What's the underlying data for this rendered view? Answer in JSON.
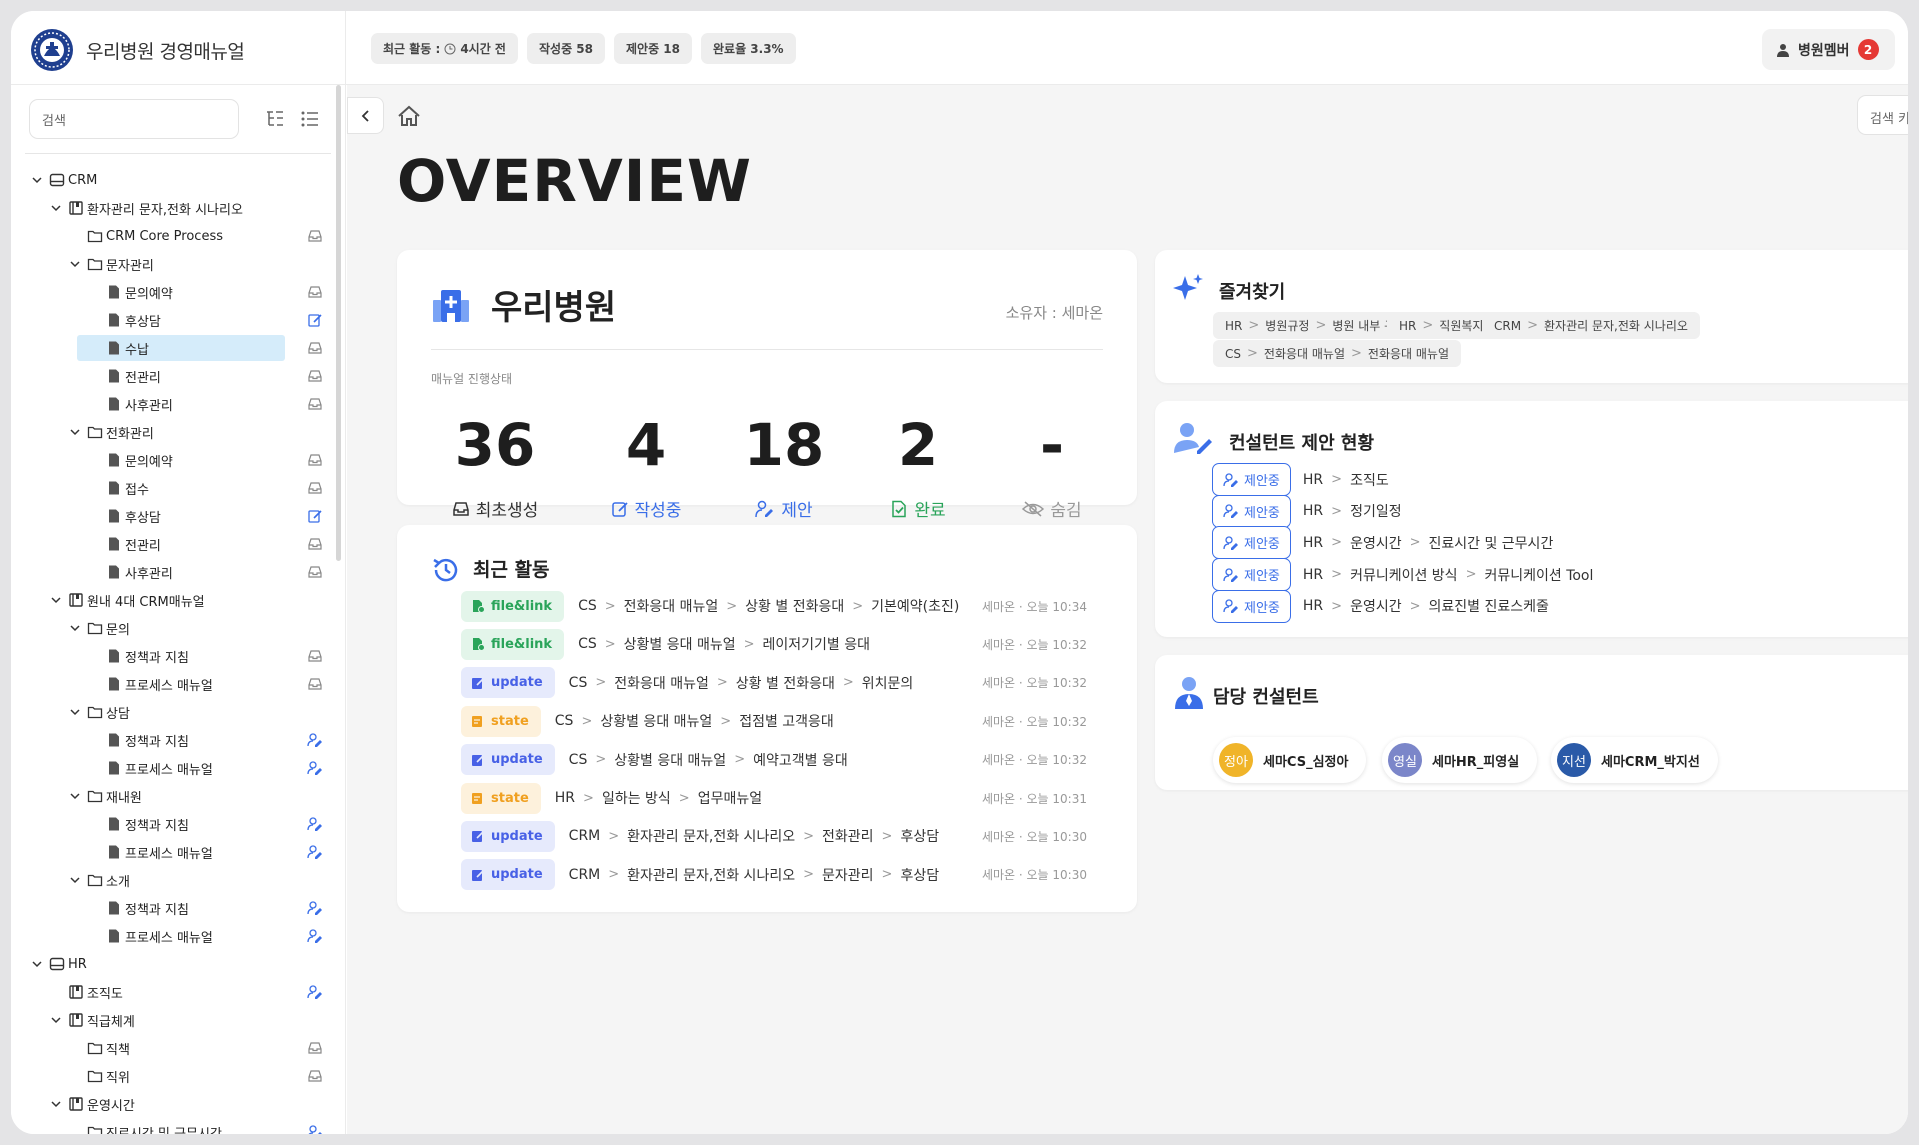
{
  "app": {
    "title": "우리병원 경영매뉴얼"
  },
  "topbar": {
    "stats": [
      {
        "label": "최근 활동 :",
        "value": "4시간 전"
      },
      {
        "label": "작성중 58"
      },
      {
        "label": "제안중 18"
      },
      {
        "label": "완료율 3.3%"
      }
    ],
    "member": {
      "label": "병원멤버",
      "count": "2"
    }
  },
  "sidebar": {
    "search_placeholder": "검색",
    "tree": [
      {
        "label": "CRM",
        "level": 0,
        "icon": "drive",
        "chevron": true
      },
      {
        "label": "환자관리 문자,전화 시나리오",
        "level": 1,
        "icon": "book",
        "chevron": true
      },
      {
        "label": "CRM Core Process",
        "level": 2,
        "icon": "folder",
        "right": "inbox"
      },
      {
        "label": "문자관리",
        "level": 2,
        "icon": "folder",
        "chevron": true
      },
      {
        "label": "문의예약",
        "level": 3,
        "icon": "doc",
        "right": "inbox"
      },
      {
        "label": "후상담",
        "level": 3,
        "icon": "doc",
        "right": "edit"
      },
      {
        "label": "수납",
        "level": 3,
        "icon": "doc",
        "right": "inbox",
        "selected": true
      },
      {
        "label": "전관리",
        "level": 3,
        "icon": "doc",
        "right": "inbox"
      },
      {
        "label": "사후관리",
        "level": 3,
        "icon": "doc",
        "right": "inbox"
      },
      {
        "label": "전화관리",
        "level": 2,
        "icon": "folder",
        "chevron": true
      },
      {
        "label": "문의예약",
        "level": 3,
        "icon": "doc",
        "right": "inbox"
      },
      {
        "label": "접수",
        "level": 3,
        "icon": "doc",
        "right": "inbox"
      },
      {
        "label": "후상담",
        "level": 3,
        "icon": "doc",
        "right": "edit"
      },
      {
        "label": "전관리",
        "level": 3,
        "icon": "doc",
        "right": "inbox"
      },
      {
        "label": "사후관리",
        "level": 3,
        "icon": "doc",
        "right": "inbox"
      },
      {
        "label": "원내 4대 CRM매뉴얼",
        "level": 1,
        "icon": "book",
        "chevron": true
      },
      {
        "label": "문의",
        "level": 2,
        "icon": "folder",
        "chevron": true
      },
      {
        "label": "정책과 지침",
        "level": 3,
        "icon": "doc",
        "right": "inbox"
      },
      {
        "label": "프로세스 매뉴얼",
        "level": 3,
        "icon": "doc",
        "right": "inbox"
      },
      {
        "label": "상담",
        "level": 2,
        "icon": "folder",
        "chevron": true
      },
      {
        "label": "정책과 지침",
        "level": 3,
        "icon": "doc",
        "right": "user"
      },
      {
        "label": "프로세스 매뉴얼",
        "level": 3,
        "icon": "doc",
        "right": "user"
      },
      {
        "label": "재내원",
        "level": 2,
        "icon": "folder",
        "chevron": true
      },
      {
        "label": "정책과 지침",
        "level": 3,
        "icon": "doc",
        "right": "user"
      },
      {
        "label": "프로세스 매뉴얼",
        "level": 3,
        "icon": "doc",
        "right": "user"
      },
      {
        "label": "소개",
        "level": 2,
        "icon": "folder",
        "chevron": true
      },
      {
        "label": "정책과 지침",
        "level": 3,
        "icon": "doc",
        "right": "user"
      },
      {
        "label": "프로세스 매뉴얼",
        "level": 3,
        "icon": "doc",
        "right": "user"
      },
      {
        "label": "HR",
        "level": 0,
        "icon": "drive",
        "chevron": true
      },
      {
        "label": "조직도",
        "level": 1,
        "icon": "book",
        "right": "user"
      },
      {
        "label": "직급체계",
        "level": 1,
        "icon": "book",
        "chevron": true
      },
      {
        "label": "직책",
        "level": 2,
        "icon": "folder",
        "right": "inbox"
      },
      {
        "label": "직위",
        "level": 2,
        "icon": "folder",
        "right": "inbox"
      },
      {
        "label": "운영시간",
        "level": 1,
        "icon": "book",
        "chevron": true
      },
      {
        "label": "진료시간 및 근무시간",
        "level": 2,
        "icon": "folder",
        "right": "user"
      }
    ]
  },
  "main": {
    "kw_search_placeholder": "검색 키워드",
    "page_title": "OVERVIEW",
    "hospital": {
      "name": "우리병원",
      "owner": "소유자 : 세마온",
      "progress_label": "매뉴얼 진행상태",
      "metrics": [
        {
          "value": "36",
          "label": "최초생성",
          "color": "#333333",
          "icon": "inbox"
        },
        {
          "value": "4",
          "label": "작성중",
          "color": "#3a6ee8",
          "icon": "edit"
        },
        {
          "value": "18",
          "label": "제안",
          "color": "#3a6ee8",
          "icon": "user"
        },
        {
          "value": "2",
          "label": "완료",
          "color": "#2aa45a",
          "icon": "check"
        },
        {
          "value": "-",
          "label": "숨김",
          "color": "#999999",
          "icon": "eye-off"
        }
      ]
    },
    "recent": {
      "title": "최근 활동",
      "items": [
        {
          "tag": "file&link",
          "type": "file",
          "path": [
            "CS",
            "전화응대 매뉴얼",
            "상황 별 전화응대",
            "기본예약(초진)"
          ],
          "meta": "세마온 · 오늘 10:34"
        },
        {
          "tag": "file&link",
          "type": "file",
          "path": [
            "CS",
            "상황별 응대 매뉴얼",
            "레이저기기별 응대"
          ],
          "meta": "세마온 · 오늘 10:32"
        },
        {
          "tag": "update",
          "type": "update",
          "path": [
            "CS",
            "전화응대 매뉴얼",
            "상황 별 전화응대",
            "위치문의"
          ],
          "meta": "세마온 · 오늘 10:32"
        },
        {
          "tag": "state",
          "type": "state",
          "path": [
            "CS",
            "상황별 응대 매뉴얼",
            "접점별 고객응대"
          ],
          "meta": "세마온 · 오늘 10:32"
        },
        {
          "tag": "update",
          "type": "update",
          "path": [
            "CS",
            "상황별 응대 매뉴얼",
            "예약고객별 응대"
          ],
          "meta": "세마온 · 오늘 10:32"
        },
        {
          "tag": "state",
          "type": "state",
          "path": [
            "HR",
            "일하는 방식",
            "업무매뉴얼"
          ],
          "meta": "세마온 · 오늘 10:31"
        },
        {
          "tag": "update",
          "type": "update",
          "path": [
            "CRM",
            "환자관리 문자,전화 시나리오",
            "전화관리",
            "후상담"
          ],
          "meta": "세마온 · 오늘 10:30"
        },
        {
          "tag": "update",
          "type": "update",
          "path": [
            "CRM",
            "환자관리 문자,전화 시나리오",
            "문자관리",
            "후상담"
          ],
          "meta": "세마온 · 오늘 10:30"
        }
      ]
    },
    "favorites": {
      "title": "즐겨찾기",
      "items": [
        [
          "HR",
          "병원규정",
          "병원 내부 규정"
        ],
        [
          "HR",
          "직원복지"
        ],
        [
          "CRM",
          "환자관리 문자,전화 시나리오"
        ],
        [
          "CS",
          "전화응대 매뉴얼",
          "전화응대 매뉴얼"
        ]
      ]
    },
    "proposals": {
      "title": "컨설턴트 제안 현황",
      "tag_label": "제안중",
      "items": [
        [
          "HR",
          "조직도"
        ],
        [
          "HR",
          "정기일정"
        ],
        [
          "HR",
          "운영시간",
          "진료시간 및 근무시간"
        ],
        [
          "HR",
          "커뮤니케이션 방식",
          "커뮤니케이션 Tool"
        ],
        [
          "HR",
          "운영시간",
          "의료진별 진료스케줄"
        ]
      ]
    },
    "consultants": {
      "title": "담당 컨설턴트",
      "items": [
        {
          "initials": "정아",
          "name": "세마CS_심정아",
          "color": "#f0b429"
        },
        {
          "initials": "영실",
          "name": "세마HR_피영실",
          "color": "#7b86c9"
        },
        {
          "initials": "지선",
          "name": "세마CRM_박지선",
          "color": "#2a5aa8"
        }
      ]
    }
  }
}
